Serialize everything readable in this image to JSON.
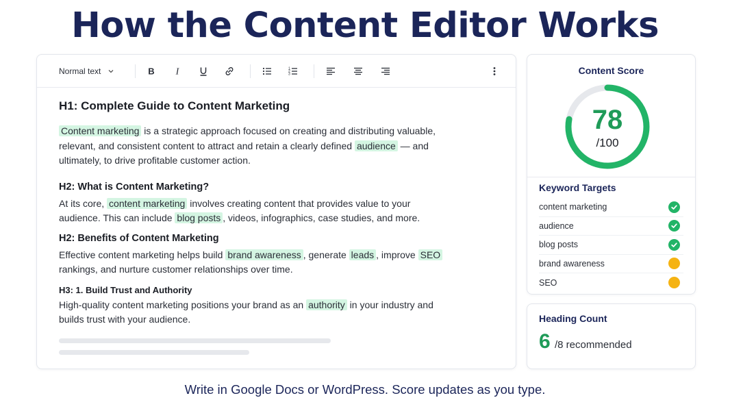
{
  "title": "How the Content Editor Works",
  "toolbar": {
    "style_select": "Normal text",
    "buttons": [
      "bold",
      "italic",
      "underline",
      "link",
      "bulleted-list",
      "numbered-list",
      "align-left",
      "align-center",
      "align-right",
      "more"
    ]
  },
  "document": {
    "h1": "H1: Complete Guide to Content Marketing",
    "p1": {
      "kw1": "Content marketing",
      "t1": " is a strategic approach focused on creating and distributing valuable,",
      "t2": "relevant, and consistent content to attract and retain a clearly defined ",
      "kw2": "audience",
      "t3": " — and",
      "t4": "ultimately, to drive profitable customer action."
    },
    "h2a": "H2: What is Content Marketing?",
    "p2": {
      "t1": "At its core, ",
      "kw1": "content marketing",
      "t2": " involves creating content that provides value to your",
      "t3": "audience. This can include ",
      "kw2": "blog posts",
      "t4": ", videos, infographics, case studies, and more."
    },
    "h2b": "H2: Benefits of Content Marketing",
    "p3": {
      "t1": "Effective content marketing helps build ",
      "kw1": "brand awareness",
      "t2": ", generate ",
      "kw2": "leads",
      "t3": ", improve ",
      "kw3": "SEO",
      "t4": "rankings, and nurture customer relationships over time."
    },
    "h3": "H3:  1.  Build Trust and Authority",
    "p4": {
      "t1": "High-quality content marketing positions your brand as an ",
      "kw1": "authority",
      "t2": " in your industry and",
      "t3": "builds trust with your audience."
    }
  },
  "score": {
    "title": "Content Score",
    "value": "78",
    "denominator": "/100",
    "fraction": 0.78
  },
  "keywords": {
    "title": "Keyword Targets",
    "items": [
      {
        "label": "content marketing",
        "status": "check-icon"
      },
      {
        "label": "audience",
        "status": "check-icon"
      },
      {
        "label": "blog posts",
        "status": "check-icon"
      },
      {
        "label": "brand awareness",
        "status": "pending-icon"
      },
      {
        "label": "SEO",
        "status": "pending-icon"
      }
    ]
  },
  "headings": {
    "title": "Heading Count",
    "count": "6",
    "recommended": "/8 recommended"
  },
  "footer": "Write in Google Docs or WordPress. Score updates as you type.",
  "colors": {
    "accent_green": "#22b467",
    "score_green": "#1f9b58",
    "warning_amber": "#f5b312",
    "navy": "#1b2559",
    "highlight": "#d4f5e2"
  }
}
